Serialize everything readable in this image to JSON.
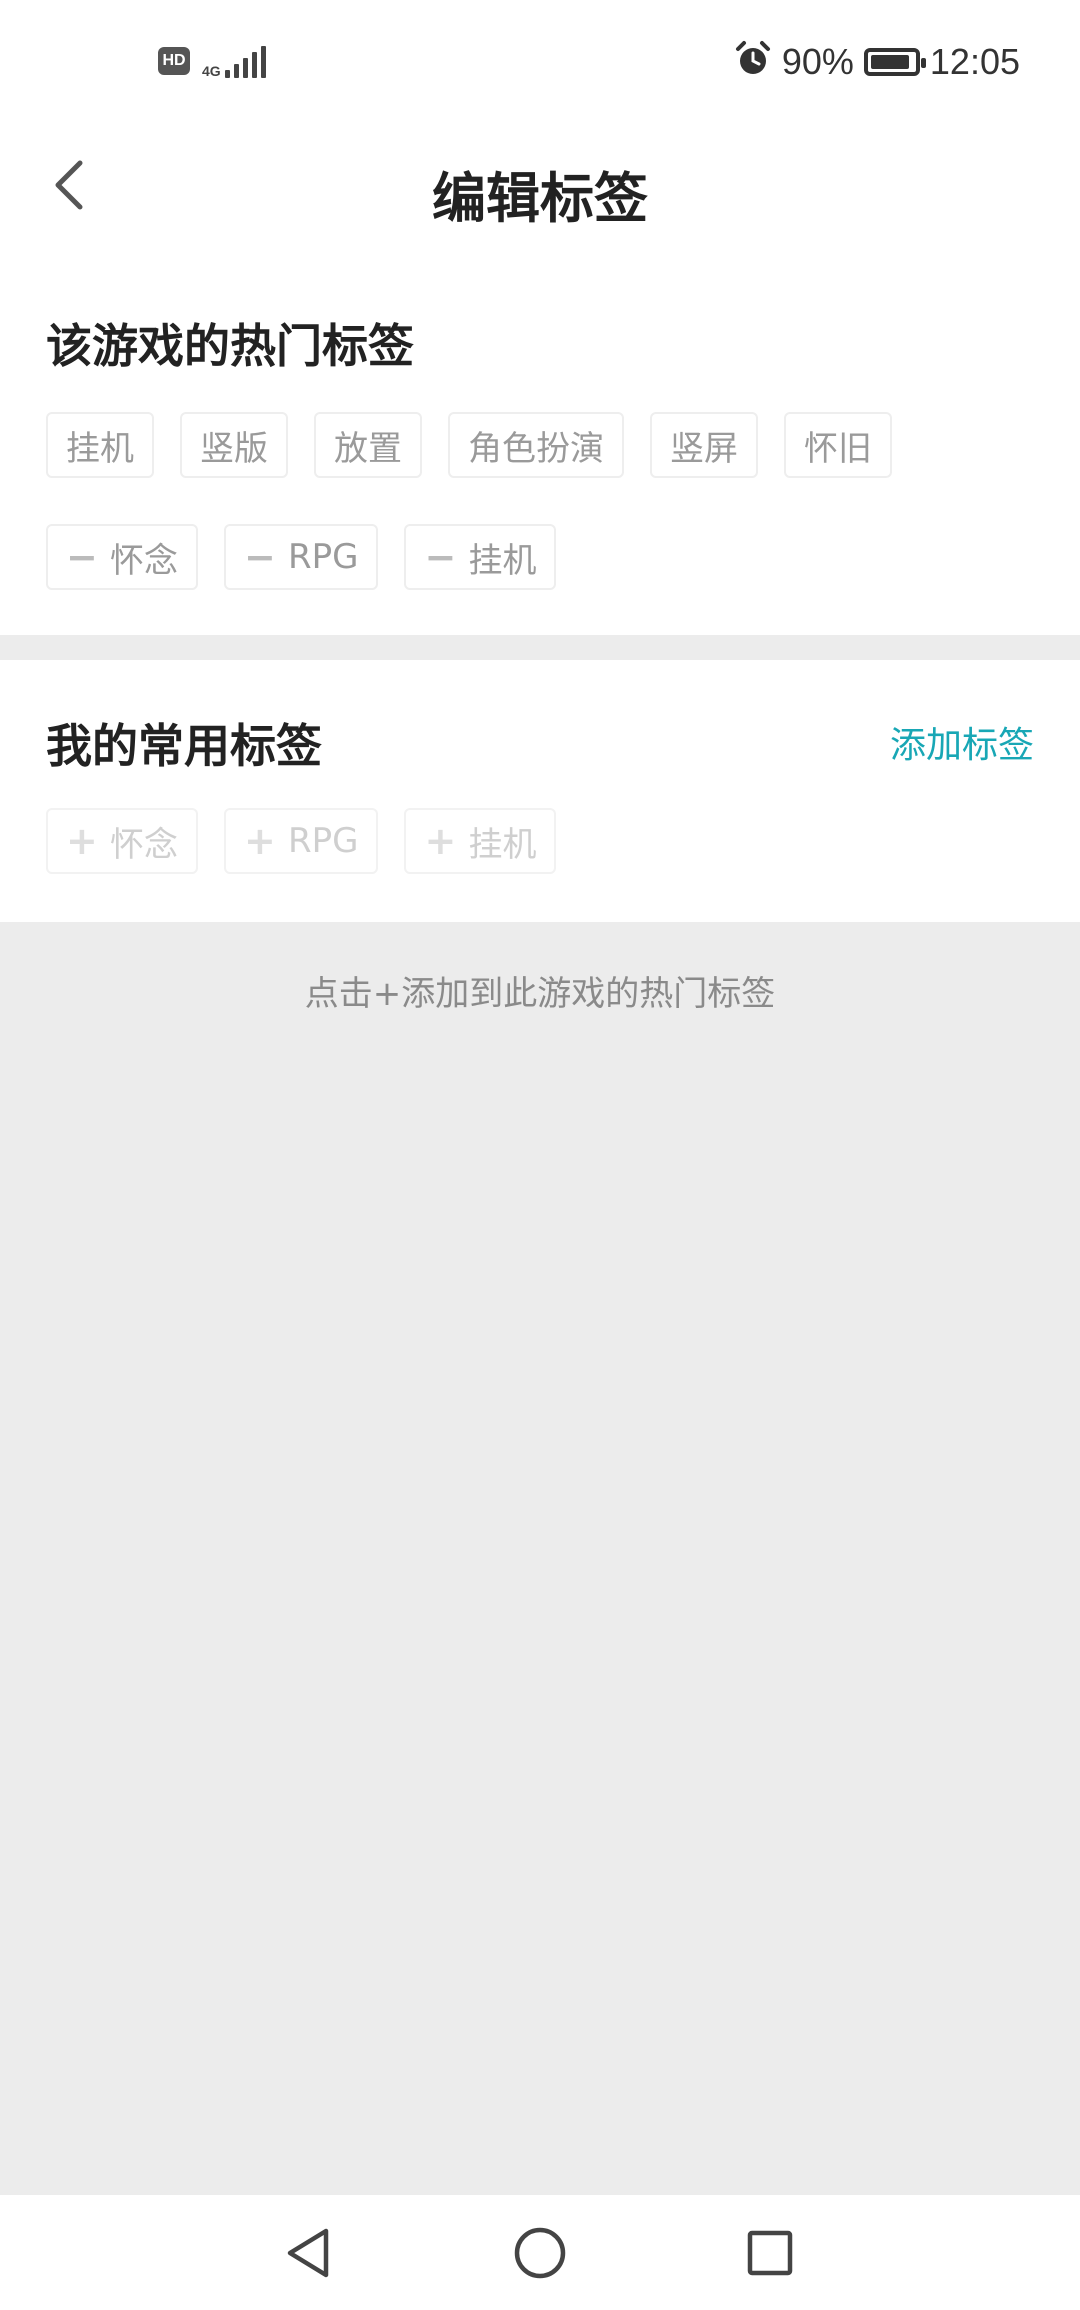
{
  "status_bar": {
    "hd_label": "HD",
    "network_label": "4G",
    "battery_percent": "90%",
    "battery_level": 0.9,
    "time": "12:05"
  },
  "header": {
    "title": "编辑标签",
    "back_icon": "chevron-left-icon"
  },
  "hot_tags_section": {
    "title": "该游戏的热门标签",
    "row1": [
      "挂机",
      "竖版",
      "放置",
      "角色扮演",
      "竖屏",
      "怀旧"
    ],
    "row2": [
      {
        "symbol": "−",
        "label": "怀念"
      },
      {
        "symbol": "−",
        "label": "RPG"
      },
      {
        "symbol": "−",
        "label": "挂机"
      }
    ]
  },
  "my_tags_section": {
    "title": "我的常用标签",
    "add_link": "添加标签",
    "tags": [
      {
        "symbol": "+",
        "label": "怀念"
      },
      {
        "symbol": "+",
        "label": "RPG"
      },
      {
        "symbol": "+",
        "label": "挂机"
      }
    ]
  },
  "hint_text": "点击+添加到此游戏的热门标签",
  "colors": {
    "accent": "#18a7b5",
    "background": "#ececec",
    "tag_text": "#9a9a9a"
  },
  "nav_bar": {
    "icons": [
      "back-triangle-icon",
      "home-circle-icon",
      "recents-square-icon"
    ]
  }
}
